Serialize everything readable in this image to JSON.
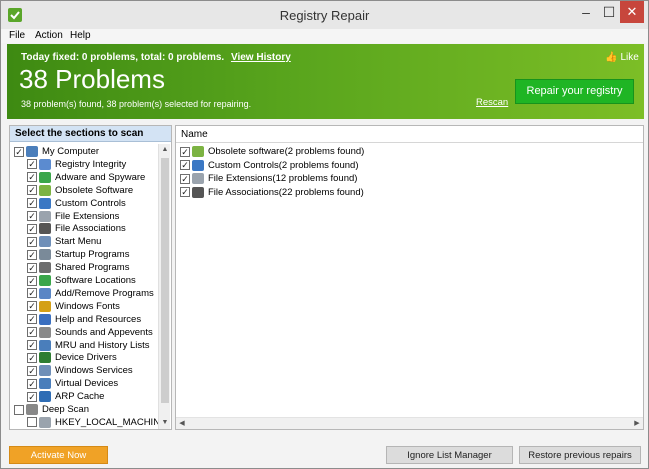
{
  "window": {
    "title": "Registry Repair",
    "min": "–",
    "max": "☐",
    "close": "✕"
  },
  "menu": [
    "File",
    "Action",
    "Help"
  ],
  "banner": {
    "fixed_text": "Today fixed: 0 problems, total: 0 problems.",
    "view_history": "View History",
    "title": "38 Problems",
    "subtitle": "38 problem(s) found, 38 problem(s) selected for repairing.",
    "like": "Like",
    "rescan": "Rescan",
    "repair_button": "Repair your registry"
  },
  "sections": {
    "header": "Select the sections to scan",
    "items": [
      {
        "label": "My Computer",
        "level": 0,
        "checked": true,
        "icon": "computer-icon",
        "color": "#4a7ebb"
      },
      {
        "label": "Registry Integrity",
        "level": 1,
        "checked": true,
        "icon": "registry-integrity-icon",
        "color": "#5b8bd0"
      },
      {
        "label": "Adware and Spyware",
        "level": 1,
        "checked": true,
        "icon": "adware-icon",
        "color": "#3aa64a"
      },
      {
        "label": "Obsolete Software",
        "level": 1,
        "checked": true,
        "icon": "obsolete-software-icon",
        "color": "#7cb342"
      },
      {
        "label": "Custom Controls",
        "level": 1,
        "checked": true,
        "icon": "custom-controls-icon",
        "color": "#3b78c4"
      },
      {
        "label": "File Extensions",
        "level": 1,
        "checked": true,
        "icon": "file-extensions-icon",
        "color": "#9aa3ad"
      },
      {
        "label": "File Associations",
        "level": 1,
        "checked": true,
        "icon": "file-associations-icon",
        "color": "#555555"
      },
      {
        "label": "Start Menu",
        "level": 1,
        "checked": true,
        "icon": "start-menu-icon",
        "color": "#6f8fb8"
      },
      {
        "label": "Startup Programs",
        "level": 1,
        "checked": true,
        "icon": "startup-programs-icon",
        "color": "#7a8a99"
      },
      {
        "label": "Shared Programs",
        "level": 1,
        "checked": true,
        "icon": "shared-programs-icon",
        "color": "#6d6d6d"
      },
      {
        "label": "Software Locations",
        "level": 1,
        "checked": true,
        "icon": "software-locations-icon",
        "color": "#3aa64a"
      },
      {
        "label": "Add/Remove Programs",
        "level": 1,
        "checked": true,
        "icon": "add-remove-programs-icon",
        "color": "#5a86c5"
      },
      {
        "label": "Windows Fonts",
        "level": 1,
        "checked": true,
        "icon": "windows-fonts-icon",
        "color": "#d4a017"
      },
      {
        "label": "Help and Resources",
        "level": 1,
        "checked": true,
        "icon": "help-resources-icon",
        "color": "#3a6fc0"
      },
      {
        "label": "Sounds and Appevents",
        "level": 1,
        "checked": true,
        "icon": "sounds-icon",
        "color": "#8a8a8a"
      },
      {
        "label": "MRU and History Lists",
        "level": 1,
        "checked": true,
        "icon": "mru-history-icon",
        "color": "#4a7ebb"
      },
      {
        "label": "Device Drivers",
        "level": 1,
        "checked": true,
        "icon": "device-drivers-icon",
        "color": "#2e7d32"
      },
      {
        "label": "Windows Services",
        "level": 1,
        "checked": true,
        "icon": "windows-services-icon",
        "color": "#6f8fb8"
      },
      {
        "label": "Virtual Devices",
        "level": 1,
        "checked": true,
        "icon": "virtual-devices-icon",
        "color": "#4a7ebb"
      },
      {
        "label": "ARP Cache",
        "level": 1,
        "checked": true,
        "icon": "arp-cache-icon",
        "color": "#2f6db5"
      },
      {
        "label": "Deep Scan",
        "level": 0,
        "checked": false,
        "icon": "deep-scan-icon",
        "color": "#888888"
      },
      {
        "label": "HKEY_LOCAL_MACHINE",
        "level": 1,
        "checked": false,
        "icon": "registry-key-icon",
        "color": "#9aa3ad"
      }
    ]
  },
  "results": {
    "column_header": "Name",
    "items": [
      {
        "label": "Obsolete software(2 problems found)",
        "checked": true,
        "icon": "obsolete-software-icon",
        "color": "#7cb342"
      },
      {
        "label": "Custom Controls(2 problems found)",
        "checked": true,
        "icon": "custom-controls-icon",
        "color": "#3b78c4"
      },
      {
        "label": "File Extensions(12 problems found)",
        "checked": true,
        "icon": "file-extensions-icon",
        "color": "#9aa3ad"
      },
      {
        "label": "File Associations(22 problems found)",
        "checked": true,
        "icon": "file-associations-icon",
        "color": "#555555"
      }
    ]
  },
  "footer": {
    "activate": "Activate Now",
    "ignore": "Ignore List Manager",
    "restore": "Restore previous repairs"
  }
}
